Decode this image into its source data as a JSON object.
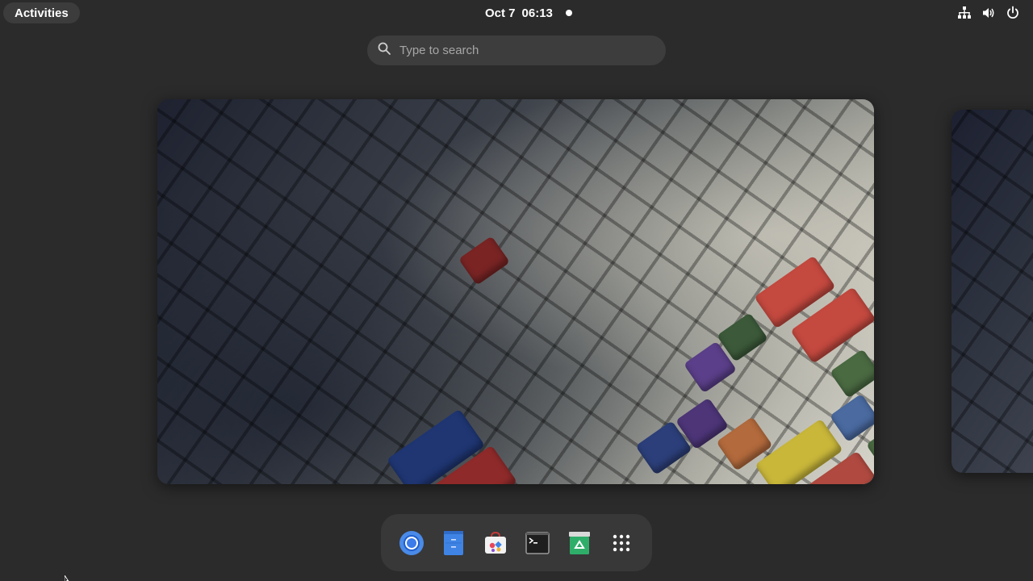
{
  "topbar": {
    "activities_label": "Activities",
    "date": "Oct 7",
    "time": "06:13",
    "tray_icons": [
      "network-icon",
      "volume-icon",
      "power-icon"
    ]
  },
  "search": {
    "placeholder": "Type to search",
    "value": ""
  },
  "workspaces": [
    {
      "name": "workspace-1",
      "wallpaper": "colorful mechanical keyboard keycaps"
    },
    {
      "name": "workspace-2",
      "wallpaper": "colorful mechanical keyboard keycaps"
    }
  ],
  "dash": {
    "apps": [
      {
        "name": "chromium-icon"
      },
      {
        "name": "files-icon"
      },
      {
        "name": "software-store-icon"
      },
      {
        "name": "terminal-icon"
      },
      {
        "name": "trash-icon"
      },
      {
        "name": "show-apps-icon"
      }
    ]
  },
  "colors": {
    "background": "#2b2b2b",
    "panel_button": "#3c3c3c",
    "search_bg": "#3d3d3d",
    "dash_bg": "#383838"
  }
}
